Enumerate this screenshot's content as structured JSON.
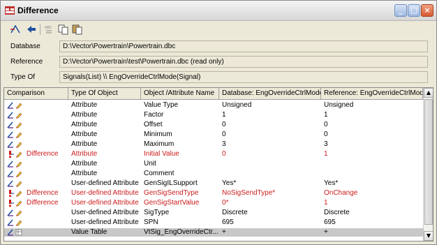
{
  "window": {
    "title": "Difference",
    "icon": "difference-window-icon",
    "controls": [
      "minimize",
      "maximize",
      "close"
    ]
  },
  "toolbar": {
    "buttons": [
      {
        "name": "compare-icon"
      },
      {
        "name": "back-arrow-icon"
      },
      {
        "name": "abc-sort-icon",
        "text": "ABC"
      },
      {
        "name": "copy-icon"
      },
      {
        "name": "paste-icon"
      }
    ]
  },
  "info": {
    "database_label": "Database",
    "database_value": "D:\\Vector\\Powertrain\\Powertrain.dbc",
    "reference_label": "Reference",
    "reference_value": "D:\\Vector\\Powertrain\\test\\Powertrain.dbc (read only)",
    "type_label": "Type Of",
    "type_value": "Signals(List) \\\\ EngOverrideCtrlMode(Signal)"
  },
  "table": {
    "columns": [
      "Comparison",
      "Type Of Object",
      "Object /Attribute Name",
      "Database: EngOverrideCtrlMode",
      "Reference: EngOverrideCtrlMode"
    ],
    "rows": [
      {
        "comparison": "",
        "type": "Attribute",
        "name": "Value Type",
        "db": "Unsigned",
        "ref": "Unsigned",
        "diff": false
      },
      {
        "comparison": "",
        "type": "Attribute",
        "name": "Factor",
        "db": "1",
        "ref": "1",
        "diff": false
      },
      {
        "comparison": "",
        "type": "Attribute",
        "name": "Offset",
        "db": "0",
        "ref": "0",
        "diff": false
      },
      {
        "comparison": "",
        "type": "Attribute",
        "name": "Minimum",
        "db": "0",
        "ref": "0",
        "diff": false
      },
      {
        "comparison": "",
        "type": "Attribute",
        "name": "Maximum",
        "db": "3",
        "ref": "3",
        "diff": false
      },
      {
        "comparison": "Difference",
        "type": "Attribute",
        "name": "Initial Value",
        "db": "0",
        "ref": "1",
        "diff": true
      },
      {
        "comparison": "",
        "type": "Attribute",
        "name": "Unit",
        "db": "",
        "ref": "",
        "diff": false
      },
      {
        "comparison": "",
        "type": "Attribute",
        "name": "Comment",
        "db": "",
        "ref": "",
        "diff": false
      },
      {
        "comparison": "",
        "type": "User-defined Attribute",
        "name": "GenSigILSupport",
        "db": "Yes*",
        "ref": "Yes*",
        "diff": false
      },
      {
        "comparison": "Difference",
        "type": "User-defined Attribute",
        "name": "GenSigSendType",
        "db": "NoSigSendType*",
        "ref": "OnChange",
        "diff": true
      },
      {
        "comparison": "Difference",
        "type": "User-defined Attribute",
        "name": "GenSigStartValue",
        "db": "0*",
        "ref": "1",
        "diff": true
      },
      {
        "comparison": "",
        "type": "User-defined Attribute",
        "name": "SigType",
        "db": "Discrete",
        "ref": "Discrete",
        "diff": false
      },
      {
        "comparison": "",
        "type": "User-defined Attribute",
        "name": "SPN",
        "db": "695",
        "ref": "695",
        "diff": false
      },
      {
        "comparison": "",
        "type": "Value Table",
        "name": "VtSig_EngOverrideCtr...",
        "db": "+",
        "ref": "+",
        "diff": false,
        "selected": true
      }
    ]
  },
  "colors": {
    "difference_text": "#cc1a1a",
    "selected_row": "#c8c8c8",
    "window_bg": "#ece9d8"
  }
}
